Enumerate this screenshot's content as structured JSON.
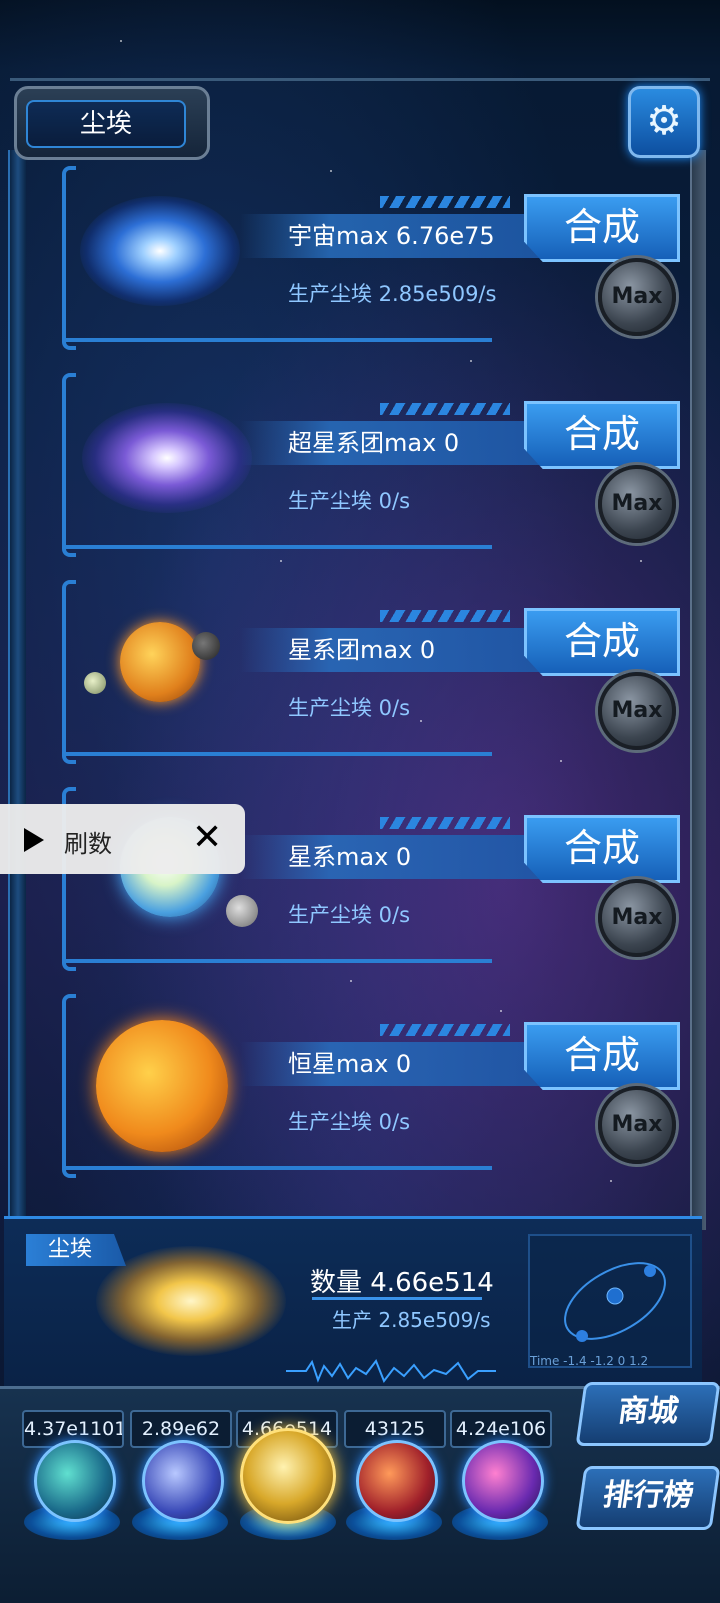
{
  "header": {
    "title": "尘埃",
    "settings_icon": "gear-icon"
  },
  "items": [
    {
      "name": "宇宙max 6.76e75",
      "production": "生产尘埃  2.85e509/s",
      "synth_label": "合成",
      "max_label": "Max",
      "planet_icon": "spiral-galaxy-icon"
    },
    {
      "name": "超星系团max 0",
      "production": "生产尘埃  0/s",
      "synth_label": "合成",
      "max_label": "Max",
      "planet_icon": "galaxy-icon"
    },
    {
      "name": "星系团max 0",
      "production": "生产尘埃  0/s",
      "synth_label": "合成",
      "max_label": "Max",
      "planet_icon": "solar-system-icon"
    },
    {
      "name": "星系max 0",
      "production": "生产尘埃  0/s",
      "synth_label": "合成",
      "max_label": "Max",
      "planet_icon": "blue-star-icon"
    },
    {
      "name": "恒星max 0",
      "production": "生产尘埃  0/s",
      "synth_label": "合成",
      "max_label": "Max",
      "planet_icon": "sun-icon"
    }
  ],
  "overlay": {
    "label": "刷数",
    "play_icon": "play-icon",
    "close_icon": "close-icon"
  },
  "dust": {
    "tag": "尘埃",
    "count": "数量 4.66e514",
    "production": "生产 2.85e509/s",
    "diagram_time_label": "Time -1.4 -1.2 0 1.2"
  },
  "resources": [
    {
      "value": "4.37e1101",
      "icon": "atom-orb-icon"
    },
    {
      "value": "2.89e62",
      "icon": "lightning-orb-icon"
    },
    {
      "value": "4.66e514",
      "icon": "dust-orb-icon"
    },
    {
      "value": "43125",
      "icon": "brain-orb-icon"
    },
    {
      "value": "4.24e106",
      "icon": "vortex-orb-icon"
    }
  ],
  "side_buttons": {
    "shop": "商城",
    "ranking": "排行榜"
  }
}
